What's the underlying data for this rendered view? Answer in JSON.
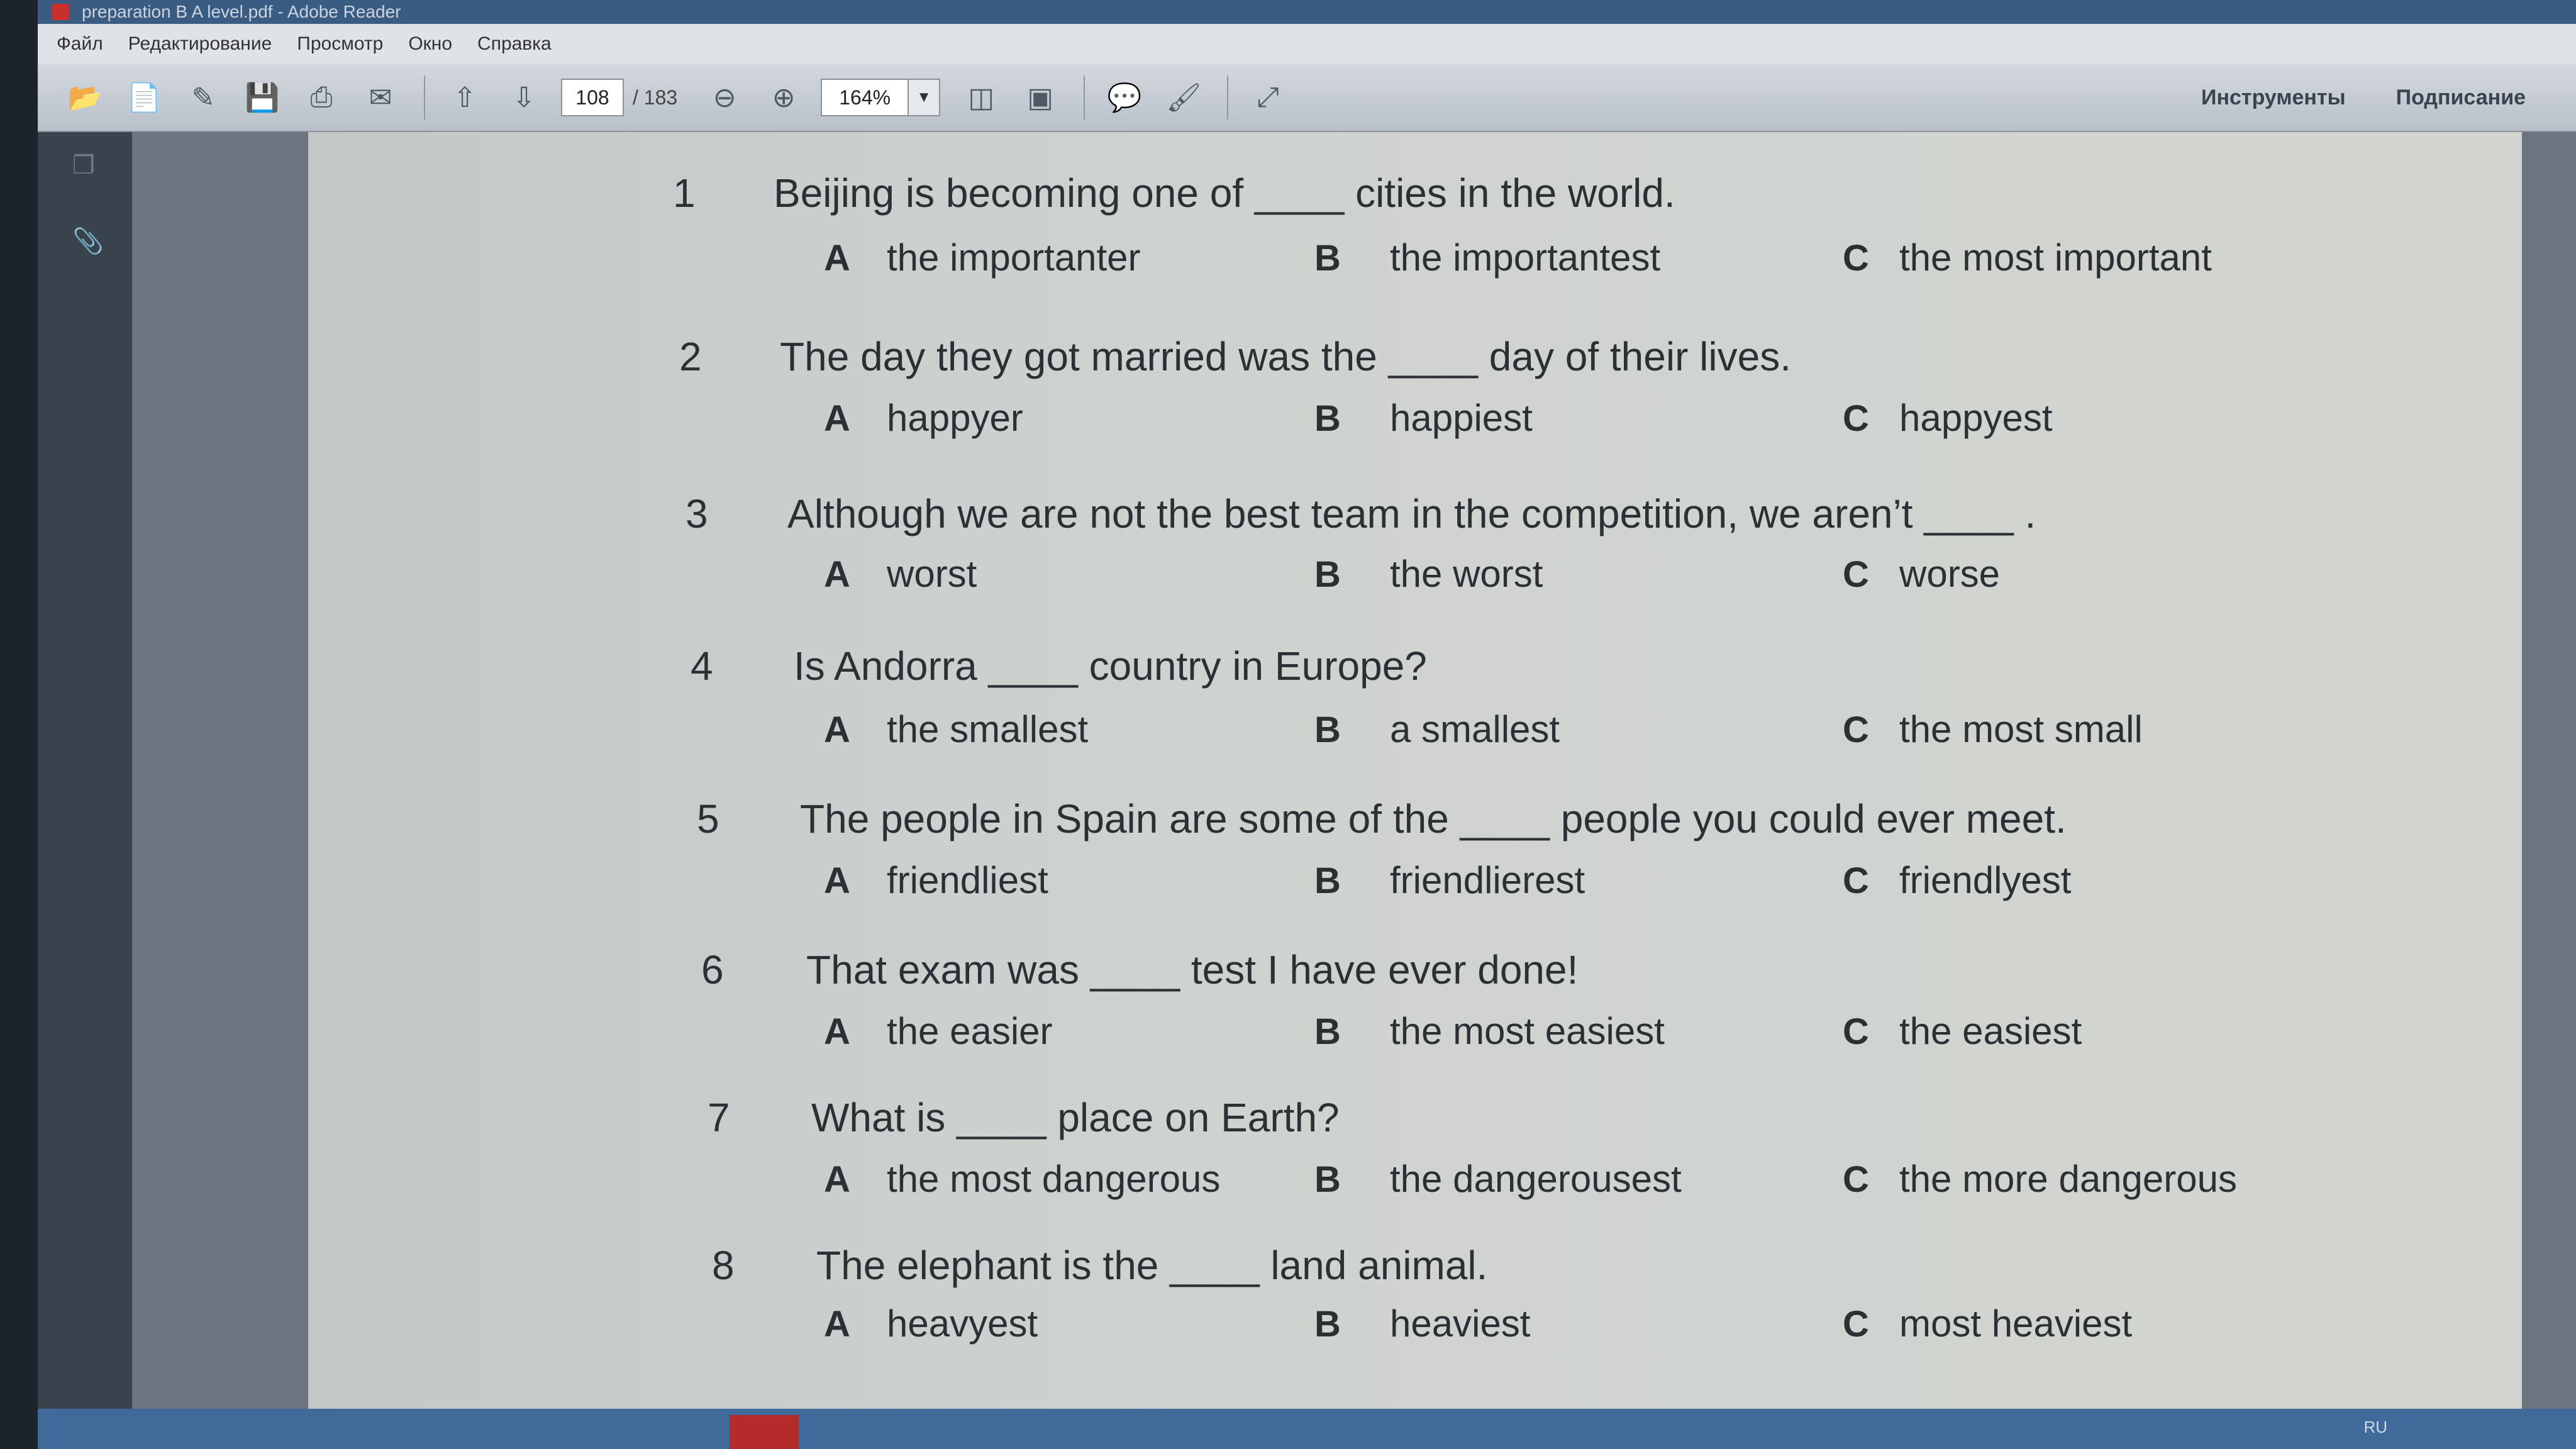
{
  "title_bar": {
    "text": "preparation B A level.pdf - Adobe Reader"
  },
  "menu": [
    "Файл",
    "Редактирование",
    "Просмотр",
    "Окно",
    "Справка"
  ],
  "toolbar": {
    "current_page": "108",
    "total_pages": "/ 183",
    "zoom": "164%",
    "tools_label": "Инструменты",
    "sign_label": "Подписание"
  },
  "questions": [
    {
      "number": "1",
      "text": "Beijing is becoming one of ____ cities in the world.",
      "options": [
        {
          "letter": "A",
          "text": "the importanter"
        },
        {
          "letter": "B",
          "text": "the importantest"
        },
        {
          "letter": "C",
          "text": "the most important"
        }
      ]
    },
    {
      "number": "2",
      "text": "The day they got married was the ____ day of their lives.",
      "options": [
        {
          "letter": "A",
          "text": "happyer"
        },
        {
          "letter": "B",
          "text": "happiest"
        },
        {
          "letter": "C",
          "text": "happyest"
        }
      ]
    },
    {
      "number": "3",
      "text": "Although we are not the best team in the competition, we aren’t ____ .",
      "options": [
        {
          "letter": "A",
          "text": "worst"
        },
        {
          "letter": "B",
          "text": "the worst"
        },
        {
          "letter": "C",
          "text": "worse"
        }
      ]
    },
    {
      "number": "4",
      "text": "Is Andorra ____ country in Europe?",
      "options": [
        {
          "letter": "A",
          "text": "the smallest"
        },
        {
          "letter": "B",
          "text": "a smallest"
        },
        {
          "letter": "C",
          "text": "the most small"
        }
      ]
    },
    {
      "number": "5",
      "text": "The people in Spain are some of the ____ people you could ever meet.",
      "options": [
        {
          "letter": "A",
          "text": "friendliest"
        },
        {
          "letter": "B",
          "text": "friendlierest"
        },
        {
          "letter": "C",
          "text": "friendlyest"
        }
      ]
    },
    {
      "number": "6",
      "text": "That exam was ____ test I have ever done!",
      "options": [
        {
          "letter": "A",
          "text": "the easier"
        },
        {
          "letter": "B",
          "text": "the most easiest"
        },
        {
          "letter": "C",
          "text": "the easiest"
        }
      ]
    },
    {
      "number": "7",
      "text": "What is ____ place on Earth?",
      "options": [
        {
          "letter": "A",
          "text": "the most dangerous"
        },
        {
          "letter": "B",
          "text": "the dangerousest"
        },
        {
          "letter": "C",
          "text": "the more dangerous"
        }
      ]
    },
    {
      "number": "8",
      "text": "The elephant is the ____ land animal.",
      "options": [
        {
          "letter": "A",
          "text": "heavyest"
        },
        {
          "letter": "B",
          "text": "heaviest"
        },
        {
          "letter": "C",
          "text": "most heaviest"
        }
      ]
    }
  ],
  "taskbar": {
    "language": "RU"
  }
}
